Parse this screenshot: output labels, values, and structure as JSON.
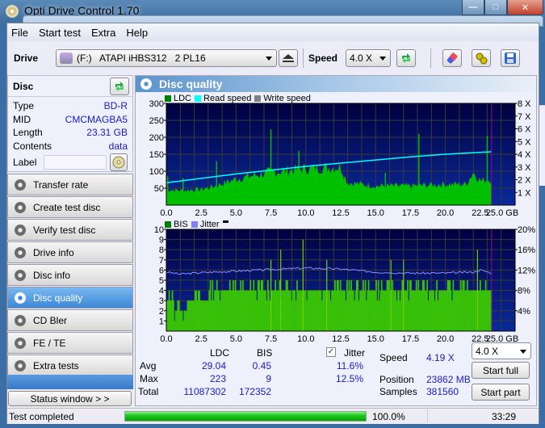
{
  "window": {
    "title": "Opti Drive Control 1.70",
    "buttons": {
      "minimize": "—",
      "maximize": "□",
      "close": "✕"
    }
  },
  "menu": [
    "File",
    "Start test",
    "Extra",
    "Help"
  ],
  "toolbar": {
    "drive_label": "Drive",
    "drive_value": "(F:)   ATAPI iHBS312   2 PL16",
    "speed_label": "Speed",
    "speed_value": "4.0 X"
  },
  "disc": {
    "header": "Disc",
    "rows": [
      {
        "label": "Type",
        "value": "BD-R"
      },
      {
        "label": "MID",
        "value": "CMCMAGBA5"
      },
      {
        "label": "Length",
        "value": "23.31 GB"
      },
      {
        "label": "Contents",
        "value": "data"
      }
    ],
    "label_field_label": "Label",
    "label_field_value": ""
  },
  "nav": [
    {
      "label": "Transfer rate",
      "active": false
    },
    {
      "label": "Create test disc",
      "active": false
    },
    {
      "label": "Verify test disc",
      "active": false
    },
    {
      "label": "Drive info",
      "active": false
    },
    {
      "label": "Disc info",
      "active": false
    },
    {
      "label": "Disc quality",
      "active": true
    },
    {
      "label": "CD Bler",
      "active": false
    },
    {
      "label": "FE / TE",
      "active": false
    },
    {
      "label": "Extra tests",
      "active": false
    }
  ],
  "status_window_button": "Status window > >",
  "main": {
    "title": "Disc quality"
  },
  "chart_data": [
    {
      "type": "bar",
      "title": "LDC / Read speed",
      "legend": [
        "LDC",
        "Read speed",
        "Write speed"
      ],
      "legend_colors": {
        "LDC": "#008000",
        "Read speed": "#00ffff",
        "Write speed": "#808080"
      },
      "xlabel": "GB",
      "x_ticks": [
        "0.0",
        "2.5",
        "5.0",
        "7.5",
        "10.0",
        "12.5",
        "15.0",
        "17.5",
        "20.0",
        "22.5",
        "25.0 GB"
      ],
      "y_ticks_left": [
        "50",
        "100",
        "150",
        "200",
        "250",
        "300"
      ],
      "y_ticks_right": [
        "1 X",
        "2 X",
        "3 X",
        "4 X",
        "5 X",
        "6 X",
        "7 X",
        "8 X"
      ],
      "xlim": [
        0,
        25
      ],
      "ylim_left": [
        0,
        300
      ],
      "ylim_right": [
        0,
        8
      ],
      "disc_end_gb": 23.31,
      "ldc_profile": {
        "x": [
          0,
          1,
          2.5,
          3.5,
          5,
          7.5,
          10,
          12.5,
          13,
          15,
          17.5,
          20,
          21.5,
          22,
          22.5,
          23.31
        ],
        "y": [
          45,
          42,
          45,
          55,
          75,
          95,
          105,
          110,
          65,
          55,
          55,
          60,
          60,
          95,
          70,
          75
        ]
      },
      "ldc_spikes": [
        {
          "x": 0.1,
          "y": 85
        },
        {
          "x": 1.2,
          "y": 80
        },
        {
          "x": 3.6,
          "y": 130
        },
        {
          "x": 7.5,
          "y": 223
        },
        {
          "x": 9.5,
          "y": 160
        },
        {
          "x": 15.7,
          "y": 95
        },
        {
          "x": 18.1,
          "y": 210
        },
        {
          "x": 23.0,
          "y": 205
        }
      ],
      "read_speed": {
        "x": [
          0,
          2.5,
          5,
          7.5,
          10,
          12.5,
          15,
          17.5,
          20,
          22.5,
          23.31
        ],
        "y": [
          1.75,
          2.1,
          2.45,
          2.75,
          3.05,
          3.3,
          3.55,
          3.8,
          4.0,
          4.15,
          4.19
        ]
      }
    },
    {
      "type": "bar",
      "title": "BIS / Jitter",
      "legend": [
        "BIS",
        "Jitter"
      ],
      "legend_colors": {
        "BIS": "#008000",
        "Jitter": "#8080ff"
      },
      "xlabel": "GB",
      "x_ticks": [
        "0.0",
        "2.5",
        "5.0",
        "7.5",
        "10.0",
        "12.5",
        "15.0",
        "17.5",
        "20.0",
        "22.5",
        "25.0 GB"
      ],
      "y_ticks_left": [
        "1",
        "2",
        "3",
        "4",
        "5",
        "6",
        "7",
        "8",
        "9",
        "10"
      ],
      "y_ticks_right": [
        "4%",
        "8%",
        "12%",
        "16%",
        "20%"
      ],
      "xlim": [
        0,
        25
      ],
      "ylim_left": [
        0,
        10
      ],
      "ylim_right": [
        0,
        20
      ],
      "disc_end_gb": 23.31,
      "bis_base": {
        "x": [
          0,
          1,
          2,
          4,
          5,
          7.5,
          10,
          12.5,
          15,
          17.5,
          20,
          22.5,
          23.31
        ],
        "y": [
          3,
          2,
          3,
          4,
          4,
          4,
          4,
          4,
          4,
          4,
          4,
          4,
          4
        ]
      },
      "bis_spikes": [
        {
          "x": 7.5,
          "y": 7
        },
        {
          "x": 8.2,
          "y": 8
        },
        {
          "x": 9.8,
          "y": 9
        },
        {
          "x": 11.5,
          "y": 7
        },
        {
          "x": 16.1,
          "y": 7
        },
        {
          "x": 17.0,
          "y": 7
        },
        {
          "x": 22.3,
          "y": 8
        }
      ],
      "jitter": {
        "x": [
          0,
          1,
          2.5,
          5,
          7.5,
          10,
          12.5,
          15,
          17.5,
          20,
          22,
          22.5,
          23.31
        ],
        "y": [
          11.6,
          11.2,
          11.5,
          11.8,
          12.1,
          12.4,
          12.2,
          11.6,
          11.4,
          11.4,
          11.6,
          12.0,
          11.4
        ]
      }
    }
  ],
  "stats": {
    "col_ldc": "LDC",
    "col_bis": "BIS",
    "jitter_label": "Jitter",
    "jitter_checked": true,
    "rows": [
      {
        "label": "Avg",
        "ldc": "29.04",
        "bis": "0.45",
        "jitter": "11.6%"
      },
      {
        "label": "Max",
        "ldc": "223",
        "bis": "9",
        "jitter": "12.5%"
      },
      {
        "label": "Total",
        "ldc": "11087302",
        "bis": "172352",
        "jitter": ""
      }
    ],
    "speed_label": "Speed",
    "speed_value": "4.19 X",
    "position_label": "Position",
    "position_value": "23862 MB",
    "samples_label": "Samples",
    "samples_value": "381560",
    "speed_select": "4.0 X",
    "start_full": "Start full",
    "start_part": "Start part"
  },
  "statusbar": {
    "text": "Test completed",
    "progress_percent": 100.0,
    "progress_label": "100.0%",
    "time": "33:29"
  }
}
